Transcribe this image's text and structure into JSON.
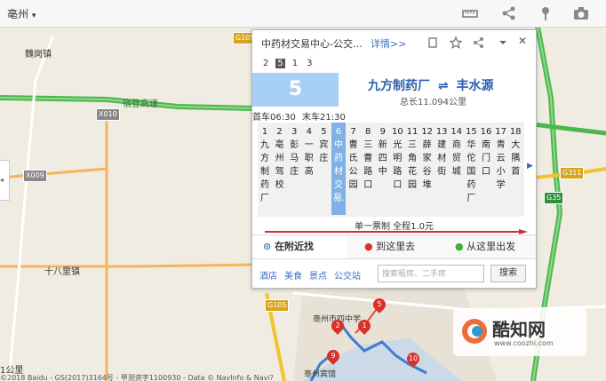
{
  "topbar": {
    "city": "亳州",
    "city_arrow": "▾"
  },
  "map_labels": [
    {
      "name": "label-weigangzhen",
      "text": "魏岗镇"
    },
    {
      "name": "label-shibalizhen",
      "text": "十八里镇"
    },
    {
      "name": "label-expressway",
      "text": "宿登高速"
    },
    {
      "name": "label-bozhou-station",
      "text": "亳州市四中学"
    },
    {
      "name": "label-bozhou-hotel",
      "text": "亳州宾馆"
    }
  ],
  "road_badges": [
    "G105",
    "X010",
    "X009",
    "G311",
    "G35",
    "G105"
  ],
  "panel": {
    "title": "中药材交易中心-公交…",
    "detail": "详情>>",
    "pages": [
      "2",
      "5",
      "1",
      "3"
    ],
    "current_page": "5",
    "route_number": "5",
    "route_from": "九方制药厂",
    "route_to": "丰水源",
    "route_arrow": "⇌",
    "total": "总长11.094公里",
    "first_bus": "首车06:30",
    "last_bus": "末车21:30",
    "stops": [
      {
        "n": "1",
        "name": "九方制药厂"
      },
      {
        "n": "2",
        "name": "亳州驾校"
      },
      {
        "n": "3",
        "name": "彭马庄"
      },
      {
        "n": "4",
        "name": "一职高"
      },
      {
        "n": "5",
        "name": "宾庄"
      },
      {
        "n": "6",
        "name": "中药材交易…"
      },
      {
        "n": "7",
        "name": "曹氏公园"
      },
      {
        "n": "8",
        "name": "三曹路口"
      },
      {
        "n": "9",
        "name": "新四中"
      },
      {
        "n": "10",
        "name": "光明路口"
      },
      {
        "n": "11",
        "name": "三角花园"
      },
      {
        "n": "12",
        "name": "薛家谷堆"
      },
      {
        "n": "13",
        "name": "建材街"
      },
      {
        "n": "14",
        "name": "商贸城"
      },
      {
        "n": "15",
        "name": "华佗国药厂"
      },
      {
        "n": "16",
        "name": "南门口"
      },
      {
        "n": "17",
        "name": "青云小学"
      },
      {
        "n": "18",
        "name": "大隅首"
      }
    ],
    "fare": "单一票制 全程1.0元",
    "tabs": [
      "在附近找",
      "到这里去",
      "从这里出发"
    ],
    "categories": [
      "酒店",
      "美食",
      "景点",
      "公交站"
    ],
    "search_placeholder": "搜索租房、二手房",
    "search_button": "搜索"
  },
  "pins": [
    "1",
    "2",
    "5",
    "9",
    "10"
  ],
  "scale": "1公里",
  "footer": "©2018 Baidu - GS(2017)3164号 - 甲测资字1100930 - Data © NavInfo & Navi?",
  "watermark": {
    "name": "酷知网",
    "url": "www.coozhi.com"
  }
}
